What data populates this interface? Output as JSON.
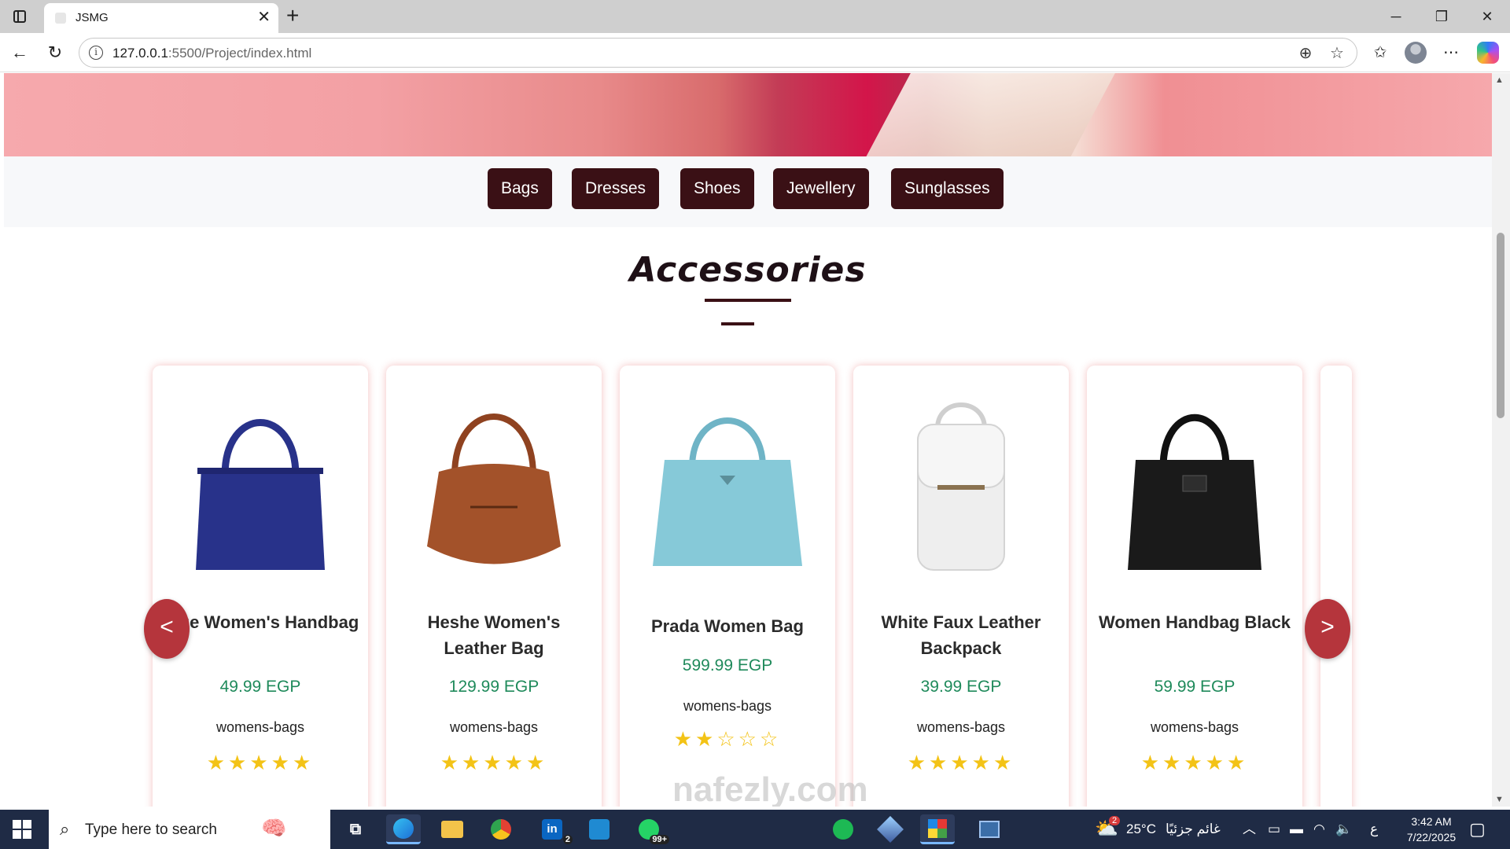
{
  "browser": {
    "tab_title": "JSMG",
    "url_host": "127.0.0.1",
    "url_rest": ":5500/Project/index.html",
    "new_tab_label": "+",
    "tab_close_label": "✕"
  },
  "categories": [
    "Bags",
    "Dresses",
    "Shoes",
    "Jewellery",
    "Sunglasses"
  ],
  "section": {
    "title": "Accessories"
  },
  "carousel": {
    "prev_label": "<",
    "next_label": ">"
  },
  "products": [
    {
      "name": "Blue Women's Handbag",
      "price": "49.99 EGP",
      "category": "womens-bags",
      "color": "#28328a",
      "rating": 5
    },
    {
      "name": "Heshe Women's Leather Bag",
      "price": "129.99 EGP",
      "category": "womens-bags",
      "color": "#a3522a",
      "rating": 5
    },
    {
      "name": "Prada Women Bag",
      "price": "599.99 EGP",
      "category": "womens-bags",
      "color": "#86c9d8",
      "rating": 2.5
    },
    {
      "name": "White Faux Leather Backpack",
      "price": "39.99 EGP",
      "category": "womens-bags",
      "color": "#eeeeee",
      "rating": 5
    },
    {
      "name": "Women Handbag Black",
      "price": "59.99 EGP",
      "category": "womens-bags",
      "color": "#1a1a1a",
      "rating": 5
    }
  ],
  "watermark": "nafezly.com",
  "taskbar": {
    "search_placeholder": "Type here to search",
    "linkedin_badge": "2",
    "whatsapp_badge": "99+",
    "weather": "25°C",
    "weather_desc": "غائم جزئيًا",
    "weather_badge": "2",
    "lang": "ع",
    "time": "3:42 AM",
    "date": "7/22/2025"
  }
}
